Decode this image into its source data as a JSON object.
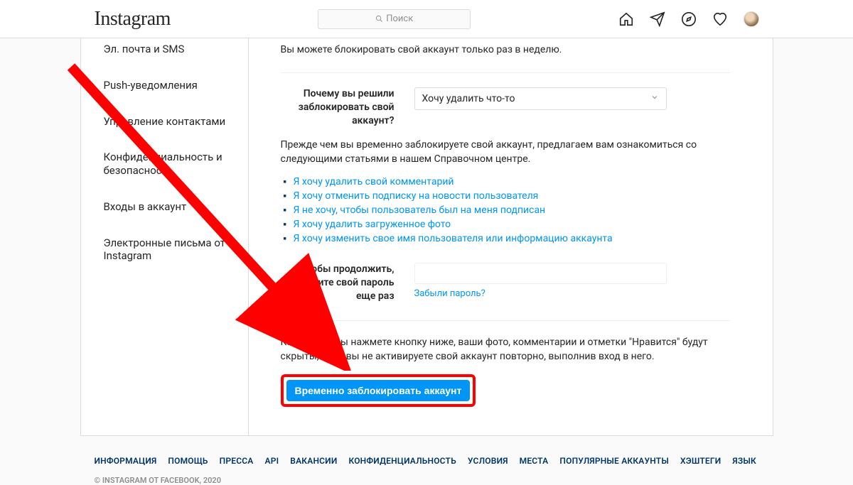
{
  "brand": "Instagram",
  "search": {
    "placeholder": "Поиск"
  },
  "sidebar": {
    "items": [
      "Эл. почта и SMS",
      "Push-уведомления",
      "Управление контактами",
      "Конфиденциальность и безопасность",
      "Входы в аккаунт",
      "Электронные письма от Instagram"
    ]
  },
  "content": {
    "notice": "Вы можете блокировать свой аккаунт только раз в неделю.",
    "reason_label": "Почему вы решили заблокировать свой аккаунт?",
    "reason_selected": "Хочу удалить что-то",
    "help_intro": "Прежде чем вы временно заблокируете свой аккаунт, предлагаем вам ознакомиться со следующими статьями в нашем Справочном центре.",
    "help_links": [
      "Я хочу удалить свой комментарий",
      "Я хочу отменить подписку на новости пользователя",
      "Я не хочу, чтобы пользователь был на меня подписан",
      "Я хочу удалить загруженное фото",
      "Я хочу изменить свое имя пользователя или информацию аккаунта"
    ],
    "password_label": "Чтобы продолжить, введите свой пароль еще раз",
    "forgot": "Забыли пароль?",
    "final_notice": "Как только вы нажмете кнопку ниже, ваши фото, комментарии и отметки \"Нравится\" будут скрыты, пока вы не активируете свой аккаунт повторно, выполнив вход в него.",
    "submit": "Временно заблокировать аккаунт"
  },
  "footer": {
    "links": [
      "Информация",
      "Помощь",
      "Пресса",
      "API",
      "Вакансии",
      "Конфиденциальность",
      "Условия",
      "Места",
      "Популярные аккаунты",
      "Хэштеги",
      "Язык"
    ],
    "copyright": "© Instagram от Facebook, 2020"
  }
}
